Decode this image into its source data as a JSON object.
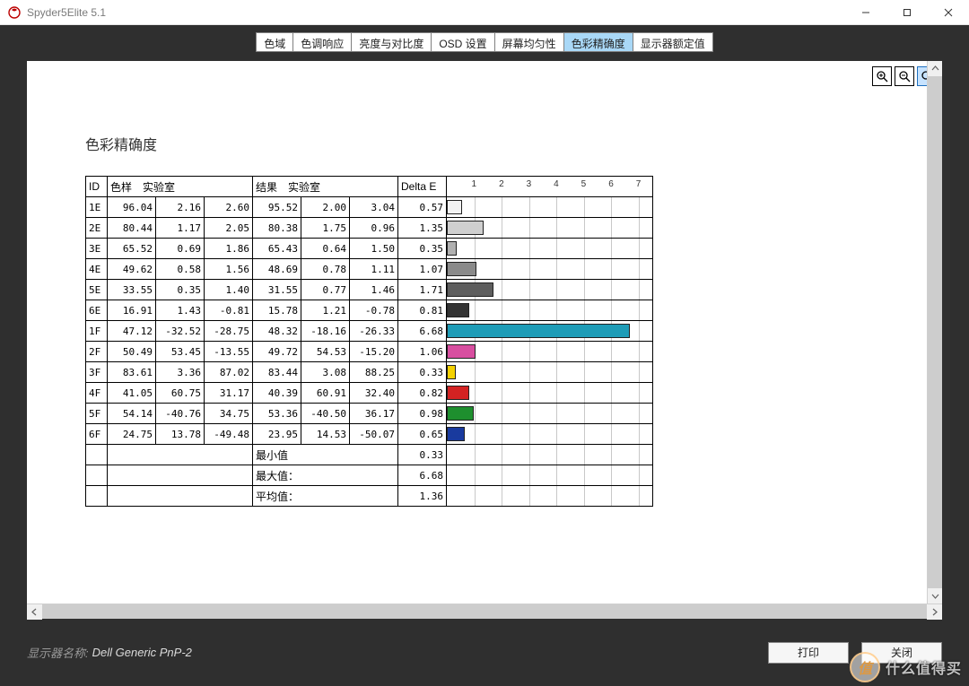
{
  "window": {
    "title": "Spyder5Elite 5.1"
  },
  "tabs": {
    "items": [
      "色域",
      "色调响应",
      "亮度与对比度",
      "OSD 设置",
      "屏幕均匀性",
      "色彩精确度",
      "显示器额定值"
    ],
    "active_index": 5
  },
  "page": {
    "title": "色彩精确度"
  },
  "table": {
    "headers": {
      "id": "ID",
      "sample": "色样",
      "lab1": "实验室",
      "result": "结果",
      "lab2": "实验室",
      "delta_e": "Delta E"
    },
    "chart_max": 7.5,
    "chart_ticks": [
      1,
      2,
      3,
      4,
      5,
      6,
      7
    ],
    "rows": [
      {
        "id": "1E",
        "sample": [
          "96.04",
          "2.16",
          "2.60"
        ],
        "result": [
          "95.52",
          "2.00",
          "3.04"
        ],
        "delta_e": "0.57",
        "bar": 0.57,
        "color": "#f2f2f2"
      },
      {
        "id": "2E",
        "sample": [
          "80.44",
          "1.17",
          "2.05"
        ],
        "result": [
          "80.38",
          "1.75",
          "0.96"
        ],
        "delta_e": "1.35",
        "bar": 1.35,
        "color": "#cfcfcf"
      },
      {
        "id": "3E",
        "sample": [
          "65.52",
          "0.69",
          "1.86"
        ],
        "result": [
          "65.43",
          "0.64",
          "1.50"
        ],
        "delta_e": "0.35",
        "bar": 0.35,
        "color": "#b0b0b0"
      },
      {
        "id": "4E",
        "sample": [
          "49.62",
          "0.58",
          "1.56"
        ],
        "result": [
          "48.69",
          "0.78",
          "1.11"
        ],
        "delta_e": "1.07",
        "bar": 1.07,
        "color": "#8a8a8a"
      },
      {
        "id": "5E",
        "sample": [
          "33.55",
          "0.35",
          "1.40"
        ],
        "result": [
          "31.55",
          "0.77",
          "1.46"
        ],
        "delta_e": "1.71",
        "bar": 1.71,
        "color": "#5e5e5e"
      },
      {
        "id": "6E",
        "sample": [
          "16.91",
          "1.43",
          "-0.81"
        ],
        "result": [
          "15.78",
          "1.21",
          "-0.78"
        ],
        "delta_e": "0.81",
        "bar": 0.81,
        "color": "#333333"
      },
      {
        "id": "1F",
        "sample": [
          "47.12",
          "-32.52",
          "-28.75"
        ],
        "result": [
          "48.32",
          "-18.16",
          "-26.33"
        ],
        "delta_e": "6.68",
        "bar": 6.68,
        "color": "#1e9cb7"
      },
      {
        "id": "2F",
        "sample": [
          "50.49",
          "53.45",
          "-13.55"
        ],
        "result": [
          "49.72",
          "54.53",
          "-15.20"
        ],
        "delta_e": "1.06",
        "bar": 1.06,
        "color": "#d84ea0"
      },
      {
        "id": "3F",
        "sample": [
          "83.61",
          "3.36",
          "87.02"
        ],
        "result": [
          "83.44",
          "3.08",
          "88.25"
        ],
        "delta_e": "0.33",
        "bar": 0.33,
        "color": "#f4d100"
      },
      {
        "id": "4F",
        "sample": [
          "41.05",
          "60.75",
          "31.17"
        ],
        "result": [
          "40.39",
          "60.91",
          "32.40"
        ],
        "delta_e": "0.82",
        "bar": 0.82,
        "color": "#d32222"
      },
      {
        "id": "5F",
        "sample": [
          "54.14",
          "-40.76",
          "34.75"
        ],
        "result": [
          "53.36",
          "-40.50",
          "36.17"
        ],
        "delta_e": "0.98",
        "bar": 0.98,
        "color": "#1e8f2e"
      },
      {
        "id": "6F",
        "sample": [
          "24.75",
          "13.78",
          "-49.48"
        ],
        "result": [
          "23.95",
          "14.53",
          "-50.07"
        ],
        "delta_e": "0.65",
        "bar": 0.65,
        "color": "#193a9e"
      }
    ],
    "stats": {
      "min_label": "最小值",
      "min": "0.33",
      "max_label": "最大值：",
      "max": "6.68",
      "avg_label": "平均值：",
      "avg": "1.36"
    }
  },
  "footer": {
    "monitor_label": "显示器名称:",
    "monitor_name": "Dell Generic PnP-2",
    "print": "打印",
    "close": "关闭"
  },
  "watermark": {
    "badge": "值",
    "text": "什么值得买"
  },
  "chart_data": {
    "type": "bar",
    "title": "色彩精确度 Delta E",
    "xlabel": "Delta E",
    "ylabel": "ID",
    "xlim": [
      0,
      7.5
    ],
    "categories": [
      "1E",
      "2E",
      "3E",
      "4E",
      "5E",
      "6E",
      "1F",
      "2F",
      "3F",
      "4F",
      "5F",
      "6F"
    ],
    "values": [
      0.57,
      1.35,
      0.35,
      1.07,
      1.71,
      0.81,
      6.68,
      1.06,
      0.33,
      0.82,
      0.98,
      0.65
    ],
    "colors": [
      "#f2f2f2",
      "#cfcfcf",
      "#b0b0b0",
      "#8a8a8a",
      "#5e5e5e",
      "#333333",
      "#1e9cb7",
      "#d84ea0",
      "#f4d100",
      "#d32222",
      "#1e8f2e",
      "#193a9e"
    ],
    "stats": {
      "min": 0.33,
      "max": 6.68,
      "avg": 1.36
    }
  }
}
